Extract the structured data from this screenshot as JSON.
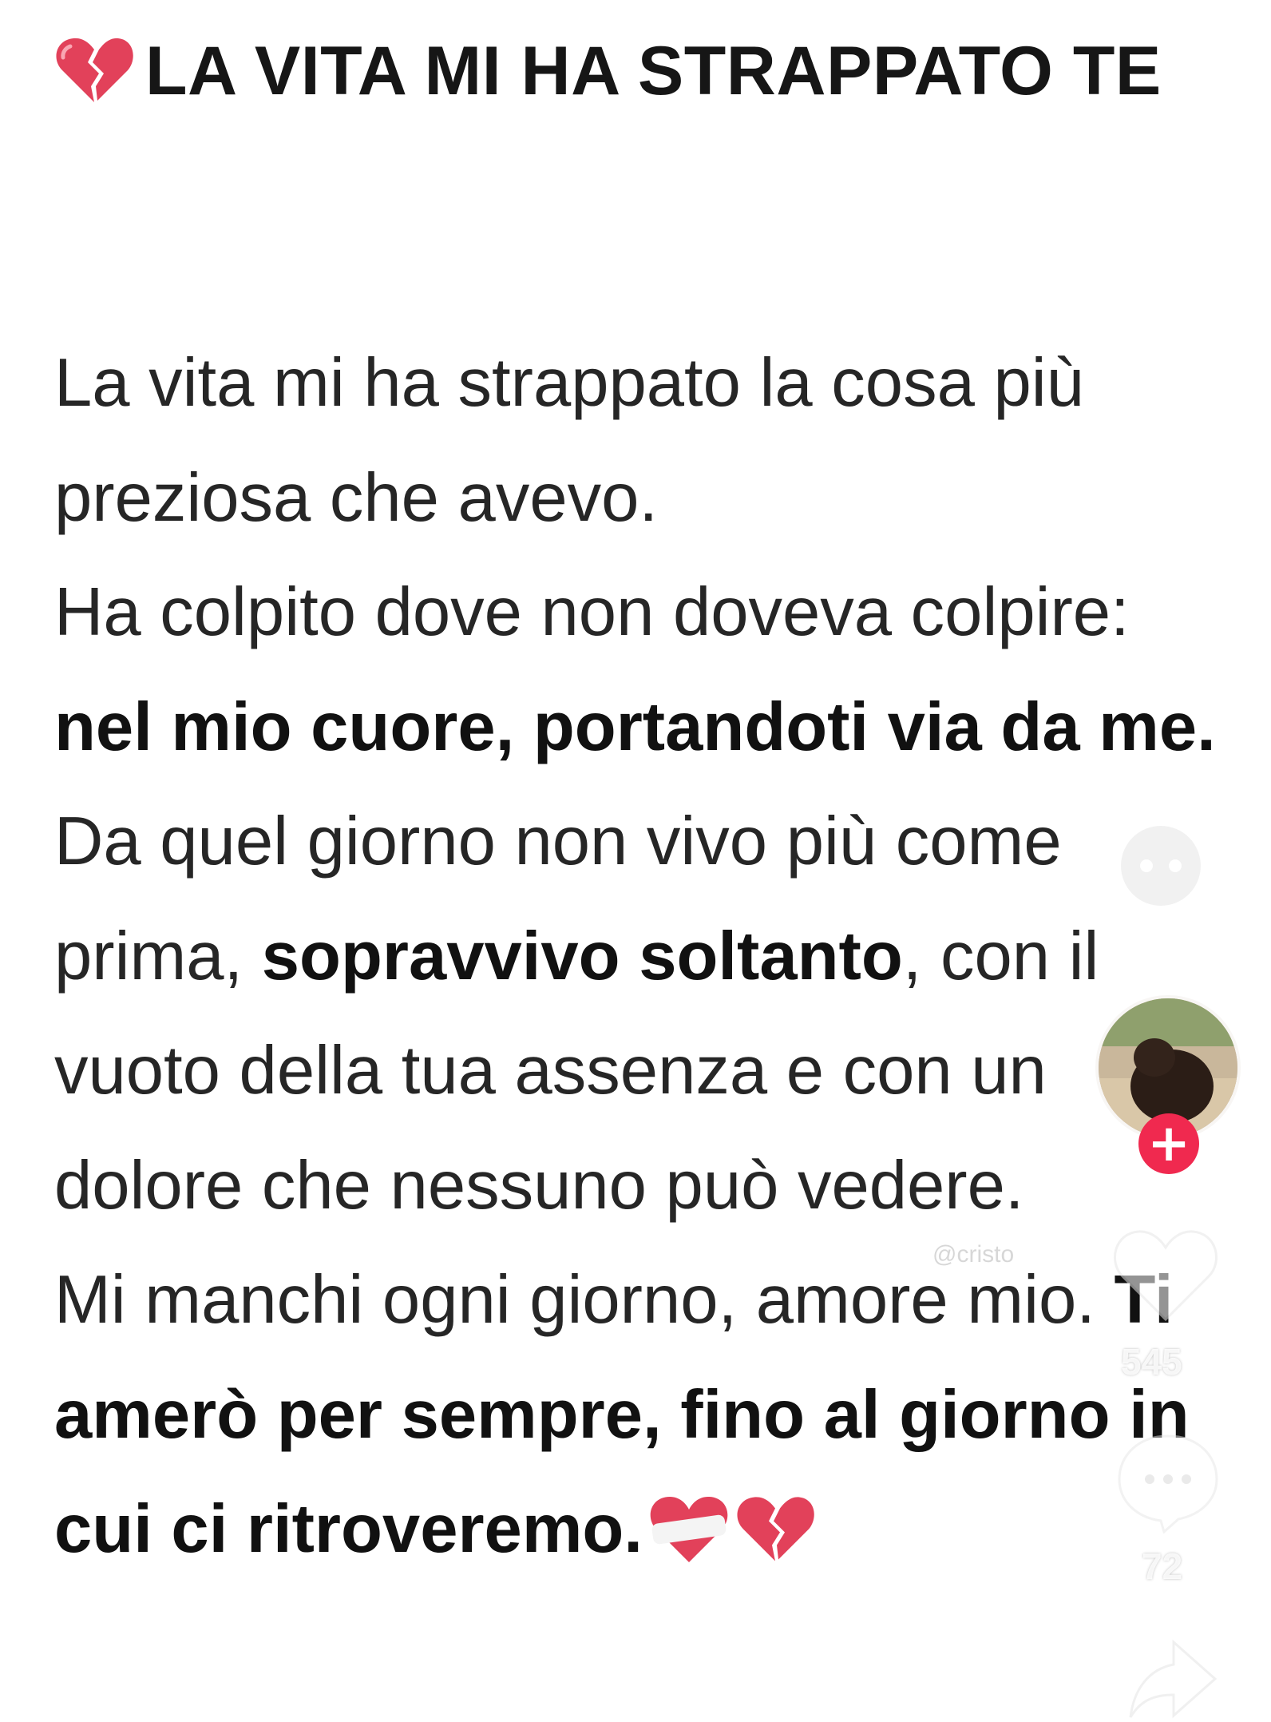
{
  "post": {
    "title": "LA VITA MI HA STRAPPATO TE",
    "title_icon": "broken-heart-icon",
    "body": {
      "l1": "La vita mi ha strappato la cosa più preziosa che avevo.",
      "l2_a": "Ha colpito dove non doveva colpire: ",
      "l2_b": "nel mio cuore, portandoti via da me.",
      "l3_a": "Da quel giorno non vivo più come prima, ",
      "l3_b": "sopravvivo soltanto",
      "l3_c": ", con il vuoto della tua assenza e con un dolore che nessuno può vedere.",
      "l4_a": "Mi manchi ogni giorno, amore mio. ",
      "l4_b": "Ti amerò per sempre, fino al giorno in cui ci ritroveremo."
    },
    "end_icons": [
      "bandaged-heart-icon",
      "broken-heart-icon"
    ]
  },
  "overlay": {
    "handle": "@cristo",
    "like_count": "545",
    "comment_count": "72",
    "follow_label": "+"
  },
  "colors": {
    "heart_red": "#e2415a",
    "follow_red": "#f0294f"
  }
}
